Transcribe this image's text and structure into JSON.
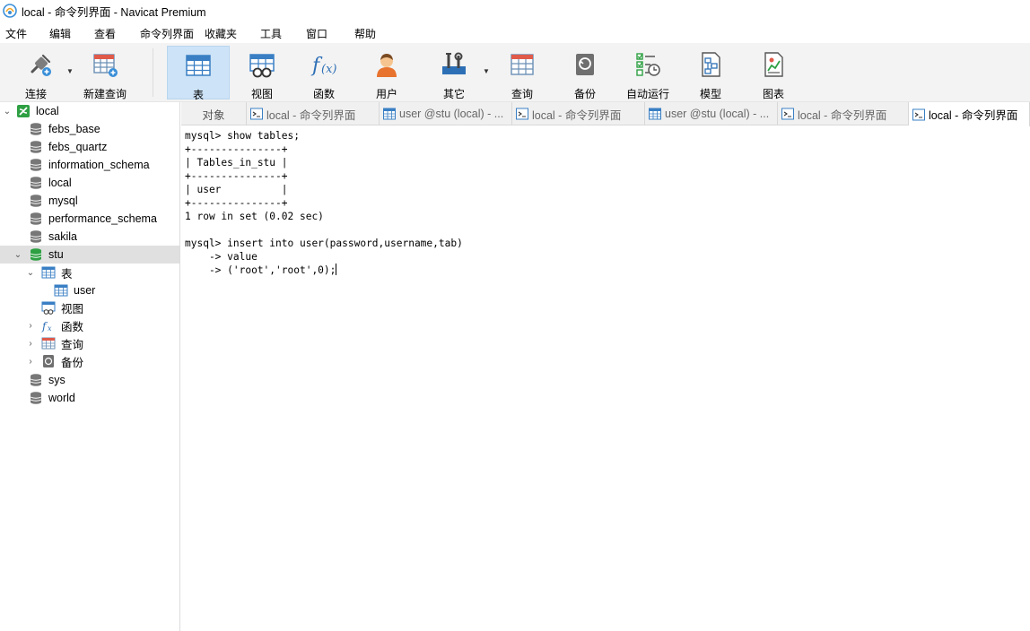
{
  "window": {
    "title": "local - 命令列界面 - Navicat Premium"
  },
  "menu": [
    "文件",
    "编辑",
    "查看",
    "命令列界面",
    "收藏夹",
    "工具",
    "窗口",
    "帮助"
  ],
  "toolbar": {
    "connect": "连接",
    "new_query": "新建查询",
    "table": "表",
    "view": "视图",
    "function": "函数",
    "user": "用户",
    "other": "其它",
    "query": "查询",
    "backup": "备份",
    "auto_run": "自动运行",
    "model": "模型",
    "chart": "图表"
  },
  "tree": {
    "connection": "local",
    "databases": [
      "febs_base",
      "febs_quartz",
      "information_schema",
      "local",
      "mysql",
      "performance_schema",
      "sakila",
      "stu"
    ],
    "stu_children": {
      "tables_label": "表",
      "table_user": "user",
      "views_label": "视图",
      "functions_label": "函数",
      "queries_label": "查询",
      "backups_label": "备份"
    },
    "databases_after": [
      "sys",
      "world"
    ]
  },
  "tabs": [
    {
      "label": "对象",
      "type": "objects"
    },
    {
      "label": "local - 命令列界面",
      "type": "console"
    },
    {
      "label": "user @stu (local) - ...",
      "type": "table"
    },
    {
      "label": "local - 命令列界面",
      "type": "console"
    },
    {
      "label": "user @stu (local) - ...",
      "type": "table"
    },
    {
      "label": "local - 命令列界面",
      "type": "console"
    },
    {
      "label": "local - 命令列界面",
      "type": "console",
      "active": true
    }
  ],
  "console": {
    "lines": [
      "mysql> show tables;",
      "+---------------+",
      "| Tables_in_stu |",
      "+---------------+",
      "| user          |",
      "+---------------+",
      "1 row in set (0.02 sec)",
      "",
      "mysql> insert into user(password,username,tab)",
      "    -> value",
      "    -> ('root','root',0);"
    ]
  },
  "colors": {
    "accent_selected": "#cde3f7",
    "db_green": "#2ea043",
    "tree_selected": "#e0e0e0"
  }
}
